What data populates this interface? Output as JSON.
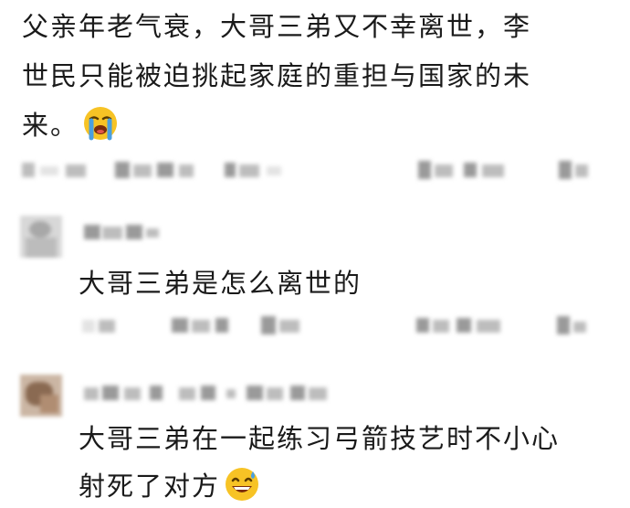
{
  "post": {
    "line1": "父亲年老气衰，大哥三弟又不幸离世，李",
    "line2": "世民只能被迫挑起家庭的重担与国家的未",
    "line3": "来。",
    "emoji": "loudly-crying-face-emoji"
  },
  "comments": [
    {
      "text": "大哥三弟是怎么离世的"
    },
    {
      "text_line1": "大哥三弟在一起练习弓箭技艺时不小心",
      "text_line2": "射死了对方",
      "emoji": "grinning-sweat-face-emoji"
    }
  ],
  "colors": {
    "text": "#1a1a1a",
    "blur_gray": "#cfcfcf",
    "emoji_yellow": "#f7c325",
    "emoji_blue": "#4a9fe0"
  }
}
